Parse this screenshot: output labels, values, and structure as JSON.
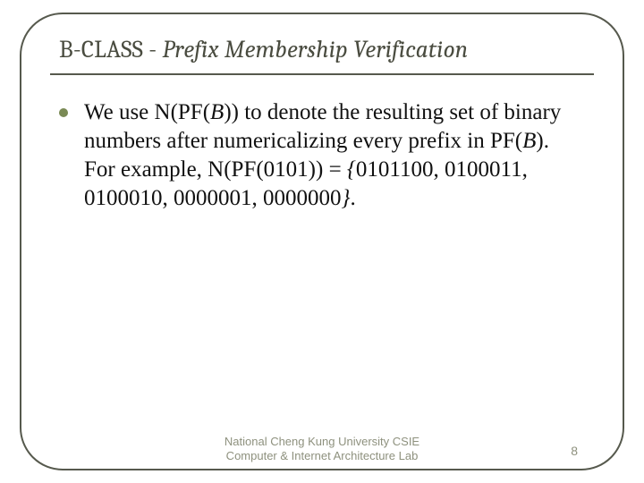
{
  "title": {
    "prefix": "B-CLASS - ",
    "italic_part": "Prefix Membership Verification"
  },
  "bullet": {
    "seg1": "We use N(PF(",
    "seg2_italic": "B",
    "seg3": ")) to denote the resulting set of binary numbers after numericalizing every prefix in PF(",
    "seg4_italic": "B",
    "seg5": "). For example, N(PF(0101)) = ",
    "seg6_italic": "{",
    "seg7": "0101100, 0100011, 0100010, 0000001, 0000000",
    "seg8_italic": "}",
    "seg9": "."
  },
  "footer": {
    "line1": "National Cheng Kung University CSIE",
    "line2": "Computer & Internet Architecture Lab",
    "page": "8"
  }
}
